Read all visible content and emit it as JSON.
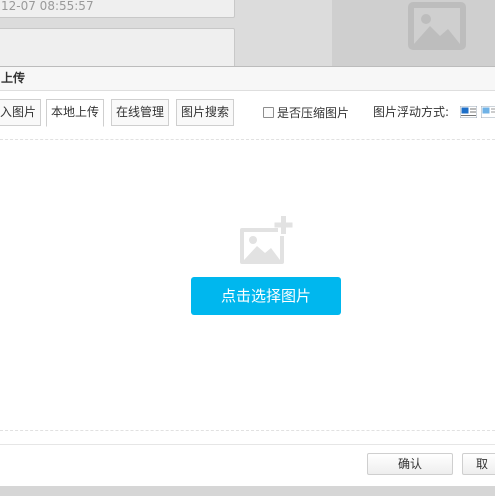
{
  "background": {
    "date_value": "12-07 08:55:57",
    "thumbnail_icon": "image-placeholder-icon"
  },
  "dialog": {
    "title": "上传",
    "tabs": [
      {
        "label": "入图片",
        "active": false
      },
      {
        "label": "本地上传",
        "active": true
      },
      {
        "label": "在线管理",
        "active": false
      },
      {
        "label": "图片搜索",
        "active": false
      }
    ],
    "compress_label": "是否压缩图片",
    "compress_checked": false,
    "float_label": "图片浮动方式:",
    "float_options": [
      "float-left-icon",
      "float-right-icon"
    ],
    "upload_icon": "add-image-icon",
    "select_button": "点击选择图片",
    "confirm_button": "确认",
    "cancel_button": "取"
  },
  "colors": {
    "accent": "#00b7ee",
    "float_icon_blue": "#1e6fc8"
  }
}
